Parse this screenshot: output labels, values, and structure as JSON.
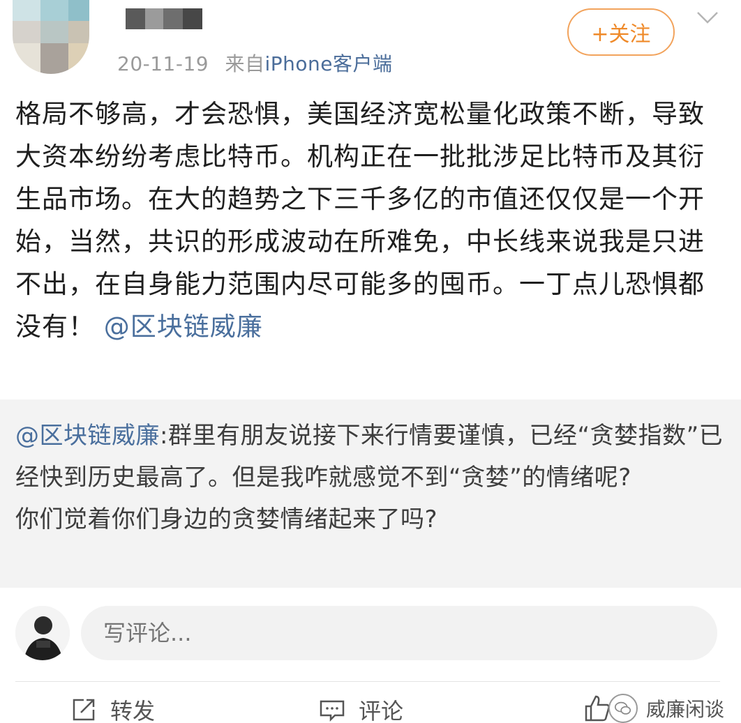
{
  "header": {
    "date": "20-11-19",
    "source_prefix": "来自",
    "source_app": "iPhone客户端",
    "follow_label": "+关注"
  },
  "post": {
    "body": "格局不够高，才会恐惧，美国经济宽松量化政策不断，导致大资本纷纷考虑比特币。机构正在一批批涉足比特币及其衍生品市场。在大的趋势之下三千多亿的市值还仅仅是一个开始，当然，共识的形成波动在所难免，中长线来说我是只进不出，在自身能力范围内尽可能多的囤币。一丁点儿恐惧都没有！",
    "mention": "@区块链威廉"
  },
  "quoted": {
    "author": "@区块链威廉",
    "text": ":群里有朋友说接下来行情要谨慎，已经“贪婪指数”已经快到历史最高了。但是我咋就感觉不到“贪婪”的情绪呢?",
    "text2": "你们觉着你们身边的贪婪情绪起来了吗?"
  },
  "comment": {
    "placeholder": "写评论..."
  },
  "actions": {
    "repost": "转发",
    "comment": "评论"
  },
  "watermark": {
    "text": "威廉闲谈"
  },
  "colors": {
    "link": "#4a6f9d",
    "follow": "#ef8a2a",
    "quote_bg": "#f3f3f3"
  },
  "icons": [
    "chevron-down-icon",
    "repost-icon",
    "comment-icon",
    "like-icon",
    "wechat-icon"
  ]
}
